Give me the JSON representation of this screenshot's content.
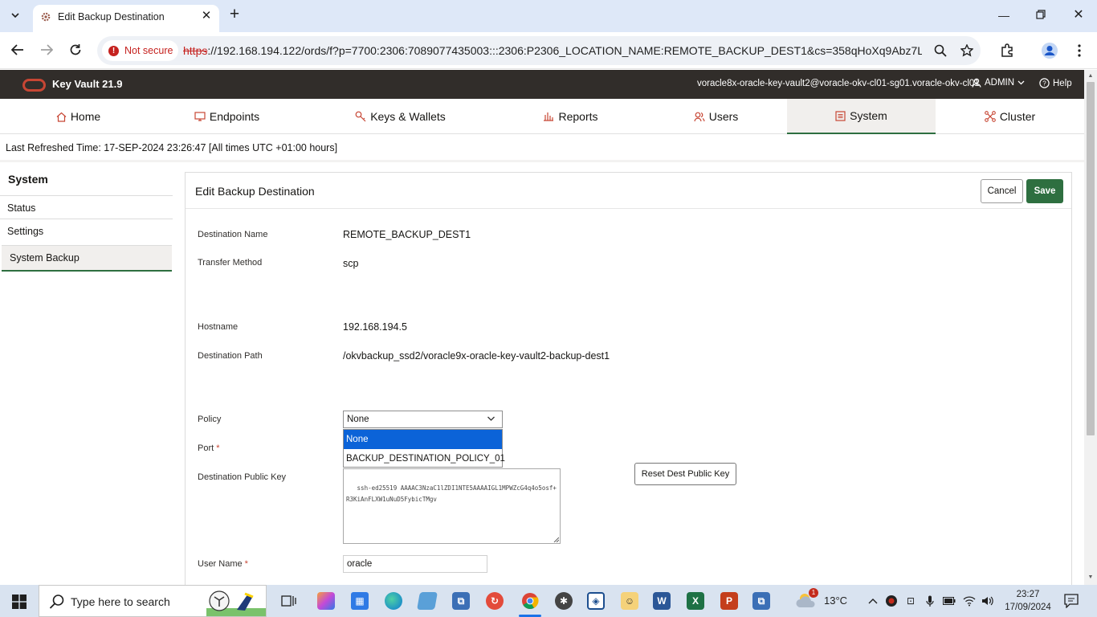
{
  "browser": {
    "tab_title": "Edit Backup Destination",
    "security_label": "Not secure",
    "url_scheme": "https",
    "url_rest": "://192.168.194.122/ords/f?p=7700:2306:7089077435003:::2306:P2306_LOCATION_NAME:REMOTE_BACKUP_DEST1&cs=358qHoXq9Abz7L6dYj8..."
  },
  "header": {
    "app_title": "Key Vault 21.9",
    "user_host": "voracle8x-oracle-key-vault2@voracle-okv-cl01-sg01.voracle-okv-cl01",
    "admin_label": "ADMIN",
    "help_label": "Help"
  },
  "nav": {
    "tabs": [
      {
        "label": "Home",
        "icon": "home-icon"
      },
      {
        "label": "Endpoints",
        "icon": "monitor-icon"
      },
      {
        "label": "Keys & Wallets",
        "icon": "key-icon"
      },
      {
        "label": "Reports",
        "icon": "bar-chart-icon"
      },
      {
        "label": "Users",
        "icon": "users-icon"
      },
      {
        "label": "System",
        "icon": "list-icon"
      },
      {
        "label": "Cluster",
        "icon": "cluster-icon"
      }
    ],
    "active": "System"
  },
  "refresh_text": "Last Refreshed Time: 17-SEP-2024 23:26:47 [All times UTC +01:00 hours]",
  "sidebar": {
    "title": "System",
    "items": [
      {
        "label": "Status"
      },
      {
        "label": "Settings"
      },
      {
        "label": "System Backup"
      }
    ],
    "active": "System Backup"
  },
  "panel": {
    "title": "Edit Backup Destination",
    "cancel_label": "Cancel",
    "save_label": "Save"
  },
  "form": {
    "destination_name": {
      "label": "Destination Name",
      "value": "REMOTE_BACKUP_DEST1"
    },
    "transfer_method": {
      "label": "Transfer Method",
      "value": "scp"
    },
    "hostname": {
      "label": "Hostname",
      "value": "192.168.194.5"
    },
    "destination_path": {
      "label": "Destination Path",
      "value": "/okvbackup_ssd2/voracle9x-oracle-key-vault2-backup-dest1"
    },
    "policy": {
      "label": "Policy",
      "value": "None",
      "options": [
        "None",
        "BACKUP_DESTINATION_POLICY_01"
      ],
      "highlighted": "None"
    },
    "port": {
      "label": "Port",
      "required_mark": "*"
    },
    "public_key": {
      "label": "Destination Public Key",
      "value": " ssh-ed25519 AAAAC3NzaC1lZDI1NTE5AAAAIGL1MPWZcG4q4o5osf+R3KiAnFLXW1uNuD5FybicTMgv",
      "reset_label": "Reset Dest Public Key"
    },
    "user_name": {
      "label": "User Name",
      "required_mark": "*",
      "value": "oracle"
    }
  },
  "taskbar": {
    "search_placeholder": "Type here to search",
    "weather_temp": "13°C",
    "weather_badge": "1",
    "time": "23:27",
    "date": "17/09/2024"
  }
}
